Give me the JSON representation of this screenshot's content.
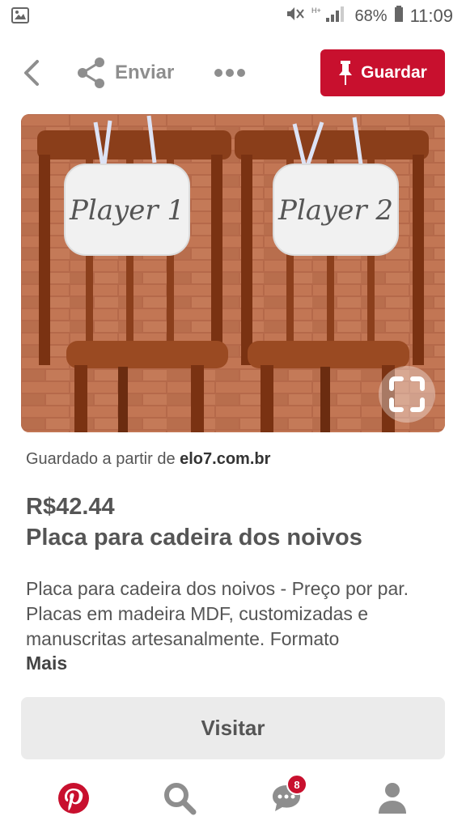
{
  "status_bar": {
    "battery_percent": "68%",
    "time": "11:09",
    "icons": [
      "image-notification-icon",
      "mute-icon",
      "signal-icon",
      "battery-icon"
    ]
  },
  "header": {
    "share_label": "Enviar",
    "save_label": "Guardar",
    "icons": [
      "back-icon",
      "share-icon",
      "more-icon",
      "pin-icon"
    ]
  },
  "pin": {
    "image_signs": [
      "Player 1",
      "Player 2"
    ],
    "source_prefix": "Guardado a partir de",
    "source_domain": "elo7.com.br",
    "price": "R$42.44",
    "title": "Placa para cadeira dos noivos",
    "description": "Placa para cadeira dos noivos - Preço por par. Placas em madeira MDF, customizadas e manuscritas artesanalmente. Formato",
    "more_label": "Mais",
    "visit_label": "Visitar"
  },
  "bottom_nav": {
    "items": [
      "home",
      "search",
      "inbox",
      "profile"
    ],
    "inbox_badge": "8"
  },
  "colors": {
    "brand_red": "#c8102e",
    "text_gray": "#555555",
    "button_gray": "#ebebeb"
  }
}
